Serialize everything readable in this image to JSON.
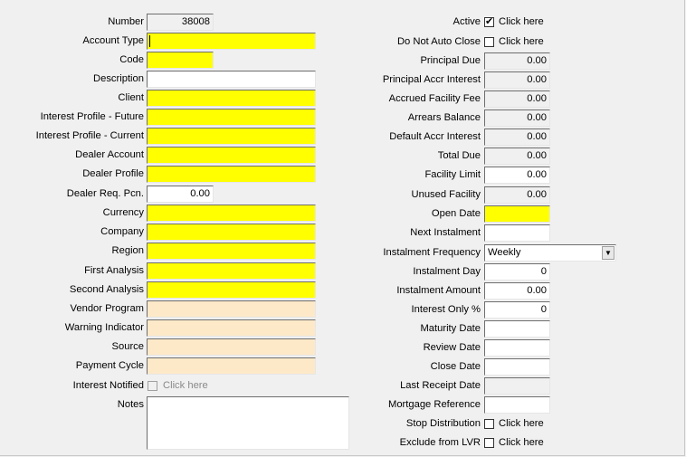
{
  "left": [
    {
      "label": "Number",
      "value": "38008",
      "style": "grey"
    },
    {
      "label": "Account Type",
      "value": "",
      "style": "yellow"
    },
    {
      "label": "Code",
      "value": "",
      "style": "yellow"
    },
    {
      "label": "Description",
      "value": "",
      "style": "white"
    },
    {
      "label": "Client",
      "value": "",
      "style": "yellow"
    },
    {
      "label": "Interest Profile - Future",
      "value": "",
      "style": "yellow"
    },
    {
      "label": "Interest Profile - Current",
      "value": "",
      "style": "yellow"
    },
    {
      "label": "Dealer Account",
      "value": "",
      "style": "yellow"
    },
    {
      "label": "Dealer Profile",
      "value": "",
      "style": "yellow"
    },
    {
      "label": "Dealer Req. Pcn.",
      "value": "0.00",
      "style": "white"
    },
    {
      "label": "Currency",
      "value": "",
      "style": "yellow"
    },
    {
      "label": "Company",
      "value": "",
      "style": "yellow"
    },
    {
      "label": "Region",
      "value": "",
      "style": "yellow"
    },
    {
      "label": "First Analysis",
      "value": "",
      "style": "yellow"
    },
    {
      "label": "Second Analysis",
      "value": "",
      "style": "yellow"
    },
    {
      "label": "Vendor Program",
      "value": "",
      "style": "peach"
    },
    {
      "label": "Warning Indicator",
      "value": "",
      "style": "peach"
    },
    {
      "label": "Source",
      "value": "",
      "style": "peach"
    },
    {
      "label": "Payment Cycle",
      "value": "",
      "style": "peach"
    }
  ],
  "interest_notified": {
    "label": "Interest Notified",
    "checkbox_text": "Click here",
    "checked": false
  },
  "notes": {
    "label": "Notes",
    "value": ""
  },
  "right": [
    {
      "label": "Active",
      "kind": "checkbox",
      "checked": true,
      "text": "Click here"
    },
    {
      "label": "Do Not Auto Close",
      "kind": "checkbox",
      "checked": false,
      "text": "Click here"
    },
    {
      "label": "Principal Due",
      "kind": "field",
      "value": "0.00",
      "style": "grey"
    },
    {
      "label": "Principal Accr Interest",
      "kind": "field",
      "value": "0.00",
      "style": "grey"
    },
    {
      "label": "Accrued Facility Fee",
      "kind": "field",
      "value": "0.00",
      "style": "grey"
    },
    {
      "label": "Arrears Balance",
      "kind": "field",
      "value": "0.00",
      "style": "grey"
    },
    {
      "label": "Default Accr Interest",
      "kind": "field",
      "value": "0.00",
      "style": "grey"
    },
    {
      "label": "Total Due",
      "kind": "field",
      "value": "0.00",
      "style": "grey"
    },
    {
      "label": "Facility Limit",
      "kind": "field",
      "value": "0.00",
      "style": "white"
    },
    {
      "label": "Unused Facility",
      "kind": "field",
      "value": "0.00",
      "style": "grey"
    },
    {
      "label": "Open Date",
      "kind": "field",
      "value": "",
      "style": "yellow"
    },
    {
      "label": "Next Instalment",
      "kind": "field",
      "value": "",
      "style": "white"
    },
    {
      "label": "Instalment Frequency",
      "kind": "select",
      "value": "Weekly"
    },
    {
      "label": "Instalment Day",
      "kind": "field",
      "value": "0",
      "style": "white"
    },
    {
      "label": "Instalment Amount",
      "kind": "field",
      "value": "0.00",
      "style": "white"
    },
    {
      "label": "Interest Only %",
      "kind": "field",
      "value": "0",
      "style": "white"
    },
    {
      "label": "Maturity Date",
      "kind": "field",
      "value": "",
      "style": "white"
    },
    {
      "label": "Review Date",
      "kind": "field",
      "value": "",
      "style": "white"
    },
    {
      "label": "Close Date",
      "kind": "field",
      "value": "",
      "style": "white"
    },
    {
      "label": "Last Receipt Date",
      "kind": "field",
      "value": "",
      "style": "grey"
    },
    {
      "label": "Mortgage Reference",
      "kind": "field",
      "value": "",
      "style": "white"
    },
    {
      "label": "Stop Distribution",
      "kind": "checkbox",
      "checked": false,
      "text": "Click here"
    },
    {
      "label": "Exclude from LVR",
      "kind": "checkbox",
      "checked": false,
      "text": "Click here"
    }
  ]
}
